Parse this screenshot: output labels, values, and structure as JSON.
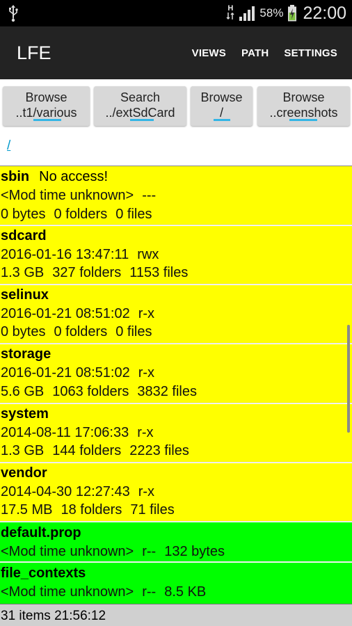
{
  "status_bar": {
    "net_type_top": "H",
    "battery_percent": "58%",
    "time": "22:00",
    "icons": [
      "usb-icon",
      "network-arrows-icon",
      "signal-icon",
      "battery-charging-icon"
    ]
  },
  "action_bar": {
    "title": "LFE",
    "menu": [
      "VIEWS",
      "PATH",
      "SETTINGS"
    ]
  },
  "bookmarks": [
    {
      "line1": "Browse",
      "line2": "..t1/various"
    },
    {
      "line1": "Search",
      "line2": "../extSdCard"
    },
    {
      "line1": "Browse",
      "line2": "/"
    },
    {
      "line1": "Browse",
      "line2": "..creenshots"
    }
  ],
  "path": "/",
  "entries": [
    {
      "name": "sbin",
      "extra": "No access!",
      "line1": [
        "<Mod time unknown>",
        "---"
      ],
      "line2": [
        "0 bytes",
        "0 folders",
        "0 files"
      ],
      "kind": "folder"
    },
    {
      "name": "sdcard",
      "extra": "",
      "line1": [
        "2016-01-16 13:47:11",
        "rwx"
      ],
      "line2": [
        "1.3 GB",
        "327 folders",
        "1153 files"
      ],
      "kind": "folder"
    },
    {
      "name": "selinux",
      "extra": "",
      "line1": [
        "2016-01-21 08:51:02",
        "r-x"
      ],
      "line2": [
        "0 bytes",
        "0 folders",
        "0 files"
      ],
      "kind": "folder"
    },
    {
      "name": "storage",
      "extra": "",
      "line1": [
        "2016-01-21 08:51:02",
        "r-x"
      ],
      "line2": [
        "5.6 GB",
        "1063 folders",
        "3832 files"
      ],
      "kind": "folder"
    },
    {
      "name": "system",
      "extra": "",
      "line1": [
        "2014-08-11 17:06:33",
        "r-x"
      ],
      "line2": [
        "1.3 GB",
        "144 folders",
        "2223 files"
      ],
      "kind": "folder"
    },
    {
      "name": "vendor",
      "extra": "",
      "line1": [
        "2014-04-30 12:27:43",
        "r-x"
      ],
      "line2": [
        "17.5 MB",
        "18 folders",
        "71 files"
      ],
      "kind": "folder"
    },
    {
      "name": "default.prop",
      "extra": "",
      "line1": [
        "<Mod time unknown>",
        "r--",
        "132 bytes"
      ],
      "line2": [],
      "kind": "file"
    },
    {
      "name": "file_contexts",
      "extra": "",
      "line1": [
        "<Mod time unknown>",
        "r--",
        "8.5 KB"
      ],
      "line2": [],
      "kind": "file"
    }
  ],
  "footer": {
    "text": "31 items  21:56:12"
  },
  "colors": {
    "folder_bg": "#ffff00",
    "file_bg": "#00ff00",
    "accent": "#33b5e5",
    "actionbar": "#232323"
  }
}
